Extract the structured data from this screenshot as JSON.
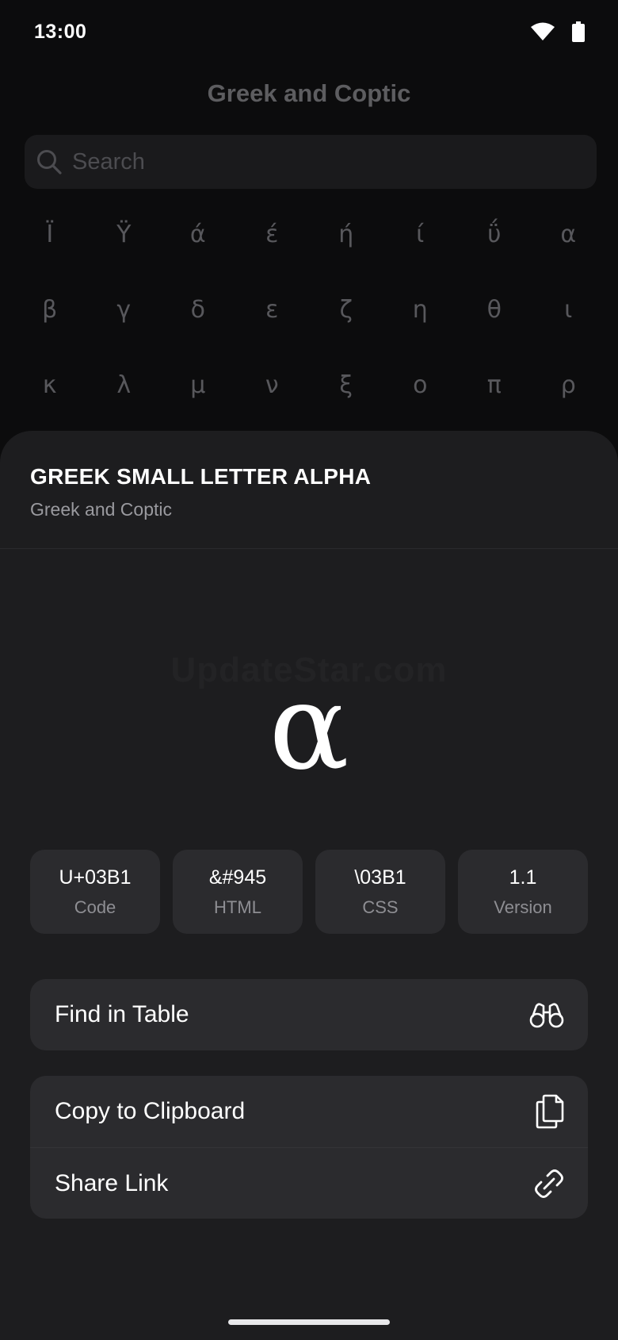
{
  "status_bar": {
    "time": "13:00"
  },
  "background": {
    "title": "Greek and Coptic",
    "search_placeholder": "Search",
    "characters": [
      "Ϊ",
      "Ϋ",
      "ά",
      "έ",
      "ή",
      "ί",
      "ΰ",
      "α",
      "β",
      "γ",
      "δ",
      "ε",
      "ζ",
      "η",
      "θ",
      "ι",
      "κ",
      "λ",
      "μ",
      "ν",
      "ξ",
      "ο",
      "π",
      "ρ"
    ]
  },
  "sheet": {
    "name": "GREEK SMALL LETTER ALPHA",
    "block": "Greek and Coptic",
    "glyph": "α",
    "watermark": "UpdateStar.com",
    "info": [
      {
        "value": "U+03B1",
        "label": "Code"
      },
      {
        "value": "&#945",
        "label": "HTML"
      },
      {
        "value": "\\03B1",
        "label": "CSS"
      },
      {
        "value": "1.1",
        "label": "Version"
      }
    ],
    "actions": {
      "find": {
        "label": "Find in Table",
        "icon": "binoculars-icon"
      },
      "copy": {
        "label": "Copy to Clipboard",
        "icon": "copy-icon"
      },
      "share": {
        "label": "Share Link",
        "icon": "link-icon"
      }
    }
  }
}
